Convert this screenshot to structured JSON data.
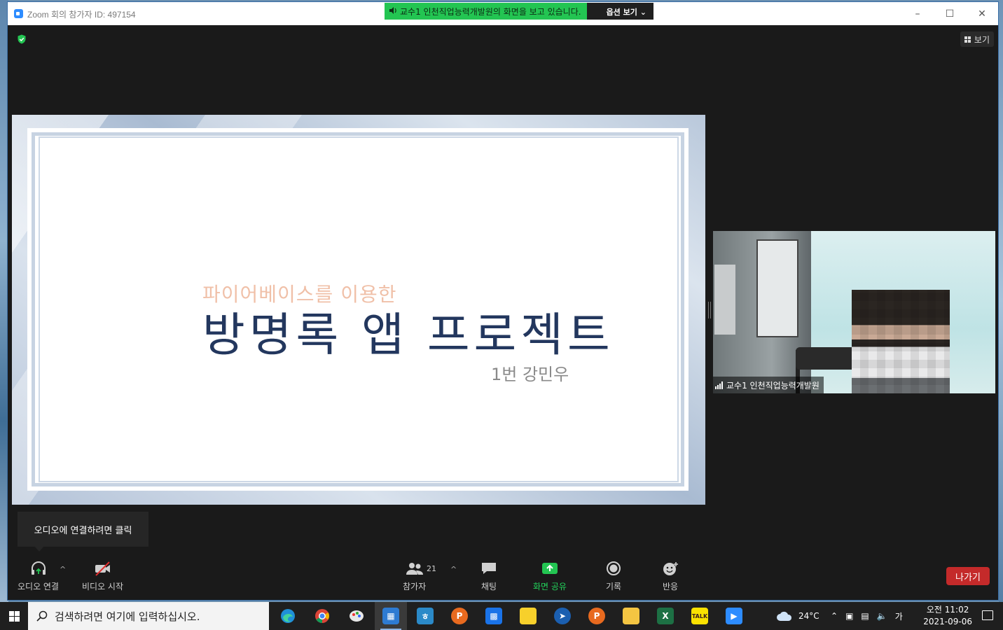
{
  "window": {
    "title": "Zoom 회의 참가자 ID: 497154",
    "share_banner": "교수1 인천직업능력개발원의 화면을 보고 있습니다.",
    "share_options": "옵션 보기",
    "view_label": "보기"
  },
  "slide": {
    "subtitle": "파이어베이스를 이용한",
    "title": "방명록 앱 프로젝트",
    "author": "1번 강민우"
  },
  "participant": {
    "name": "교수1 인천직업능력개발원"
  },
  "tooltip": "오디오에 연결하려면 클릭",
  "toolbar": {
    "audio": "오디오 연결",
    "video": "비디오 시작",
    "participants": "참가자",
    "participant_count": "21",
    "chat": "채팅",
    "share": "화면 공유",
    "record": "기록",
    "reactions": "반응",
    "leave": "나가기",
    "share_color": "#23d25b",
    "leave_color": "#c42a2a"
  },
  "taskbar": {
    "search_placeholder": "검색하려면 여기에 입력하십시오.",
    "apps": [
      "edge-icon",
      "chrome-icon",
      "paint-icon",
      "calculator-icon",
      "hangul-icon",
      "powerpoint-icon",
      "calendar-icon",
      "sticky-notes-icon",
      "pilot-icon",
      "powerpoint-icon",
      "file-explorer-icon",
      "excel-icon",
      "kakaotalk-icon",
      "zoom-icon"
    ],
    "weather_temp": "24°C",
    "ime": "가",
    "time": "오전 11:02",
    "date": "2021-09-06"
  }
}
